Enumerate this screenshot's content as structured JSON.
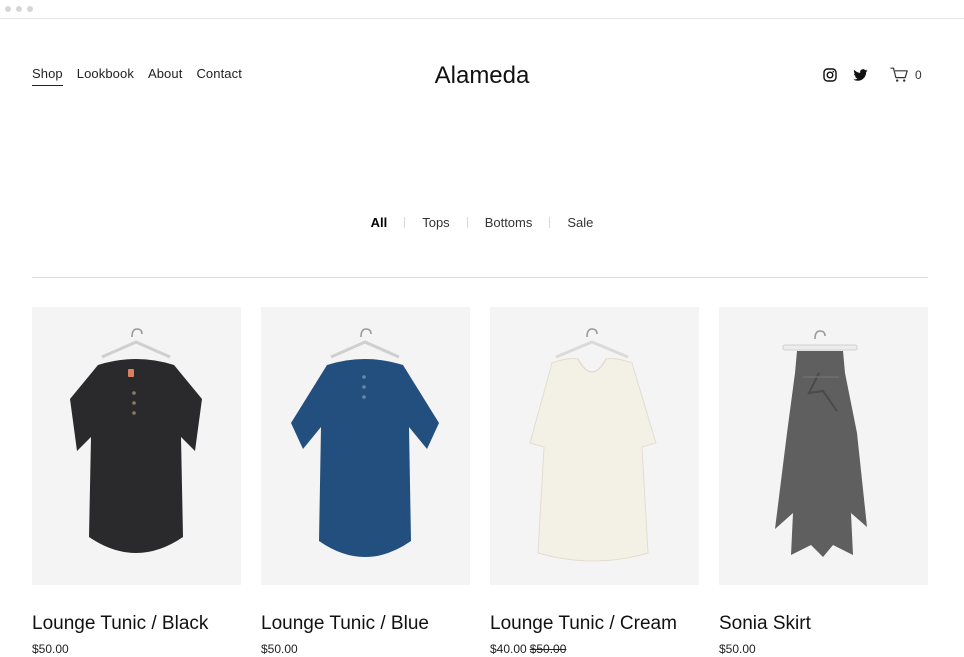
{
  "header": {
    "nav": [
      {
        "label": "Shop",
        "active": true
      },
      {
        "label": "Lookbook"
      },
      {
        "label": "About"
      },
      {
        "label": "Contact"
      }
    ],
    "brand": "Alameda",
    "social": [
      {
        "icon": "instagram-icon"
      },
      {
        "icon": "twitter-icon"
      }
    ],
    "cart": {
      "icon": "cart-icon",
      "count": "0"
    }
  },
  "filters": {
    "items": [
      {
        "label": "All",
        "active": true
      },
      {
        "label": "Tops"
      },
      {
        "label": "Bottoms"
      },
      {
        "label": "Sale"
      }
    ]
  },
  "products": [
    {
      "name": "Lounge Tunic / Black",
      "price": "$50.00",
      "original_price": "",
      "garment_color": "#2a2a2c"
    },
    {
      "name": "Lounge Tunic / Blue",
      "price": "$50.00",
      "original_price": "",
      "garment_color": "#234f7f"
    },
    {
      "name": "Lounge Tunic / Cream",
      "price": "$40.00",
      "original_price": "$50.00",
      "garment_color": "#f3f0e6"
    },
    {
      "name": "Sonia Skirt",
      "price": "$50.00",
      "original_price": "",
      "garment_color": "#5f5f5f"
    }
  ],
  "colors": {
    "text": "#1a1a1a",
    "photo_bg": "#f4f4f4",
    "divider": "#dcdcdc"
  }
}
